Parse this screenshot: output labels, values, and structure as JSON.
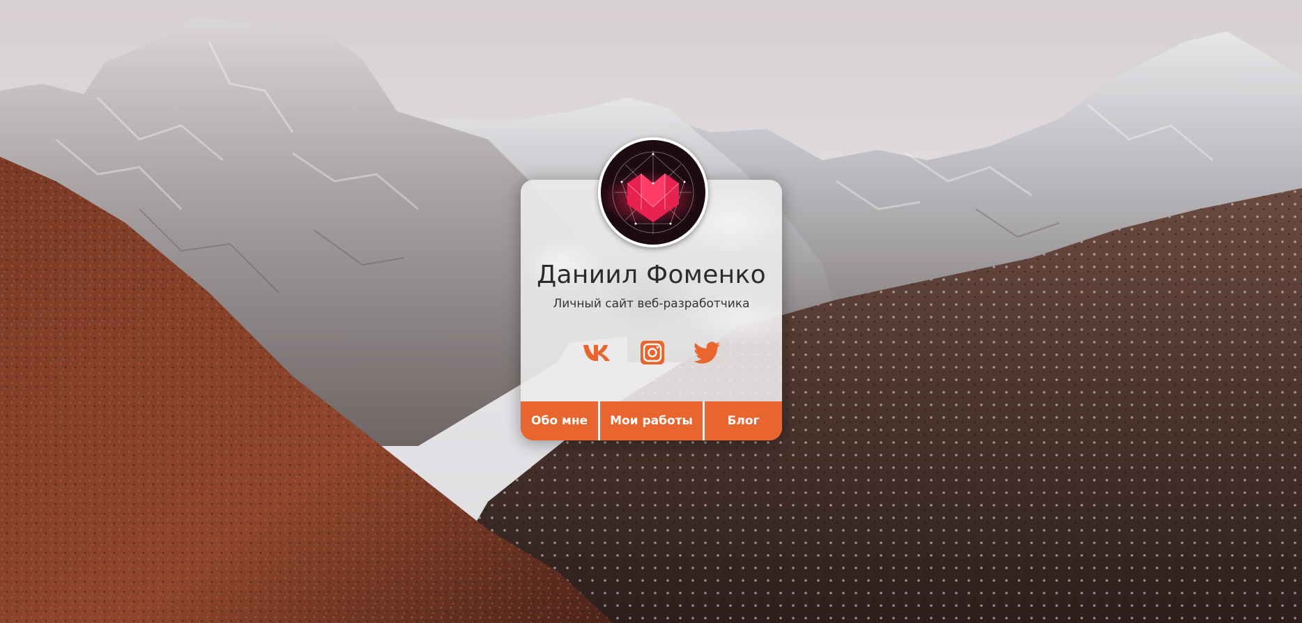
{
  "profile": {
    "name": "Даниил Фоменко",
    "subtitle": "Личный сайт веб-разработчика",
    "avatar_icon": "geometric-logo"
  },
  "socials": [
    {
      "name": "vk",
      "icon": "vk-icon"
    },
    {
      "name": "instagram",
      "icon": "instagram-icon"
    },
    {
      "name": "twitter",
      "icon": "twitter-icon"
    }
  ],
  "nav": {
    "about": "Обо мне",
    "works": "Мои работы",
    "blog": "Блог"
  },
  "colors": {
    "accent": "#e8652f",
    "card": "#ecebeb",
    "text": "#2b2b2b"
  }
}
